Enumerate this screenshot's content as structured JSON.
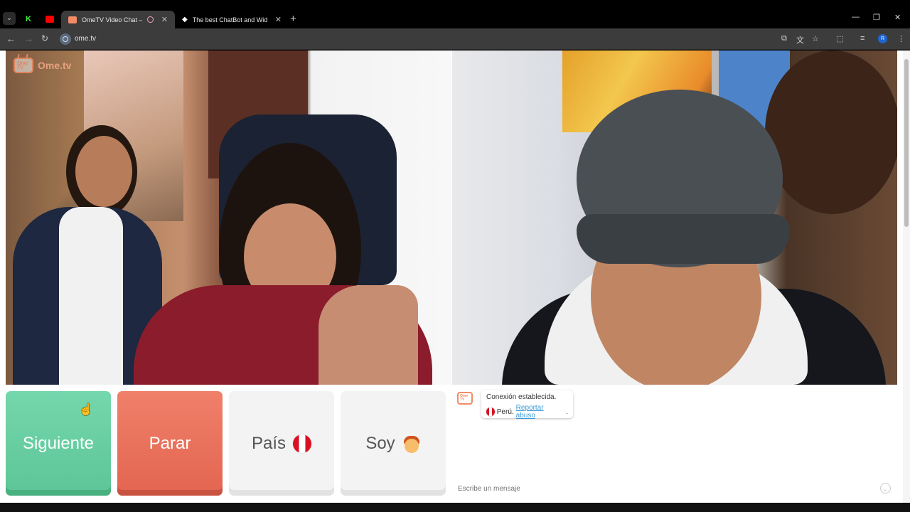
{
  "browser": {
    "tabs": [
      {
        "title": "OmeTV Video Chat — Ome",
        "active": true
      },
      {
        "title": "The best ChatBot and Widgets",
        "active": false
      }
    ],
    "url": "ome.tv"
  },
  "site": {
    "brand": "Ome.tv",
    "logo_text": "Ome TV"
  },
  "controls": {
    "next": "Siguiente",
    "stop": "Parar",
    "country": "País",
    "gender": "Soy"
  },
  "chat": {
    "status": "Conexión establecida.",
    "country": "Perú.",
    "report": "Reportar abuso",
    "report_suffix": ".",
    "input_placeholder": "Escribe un mensaje"
  },
  "colors": {
    "next": "#5cc597",
    "stop": "#e26550",
    "brand": "#f28b66",
    "link": "#3a9ad9"
  }
}
